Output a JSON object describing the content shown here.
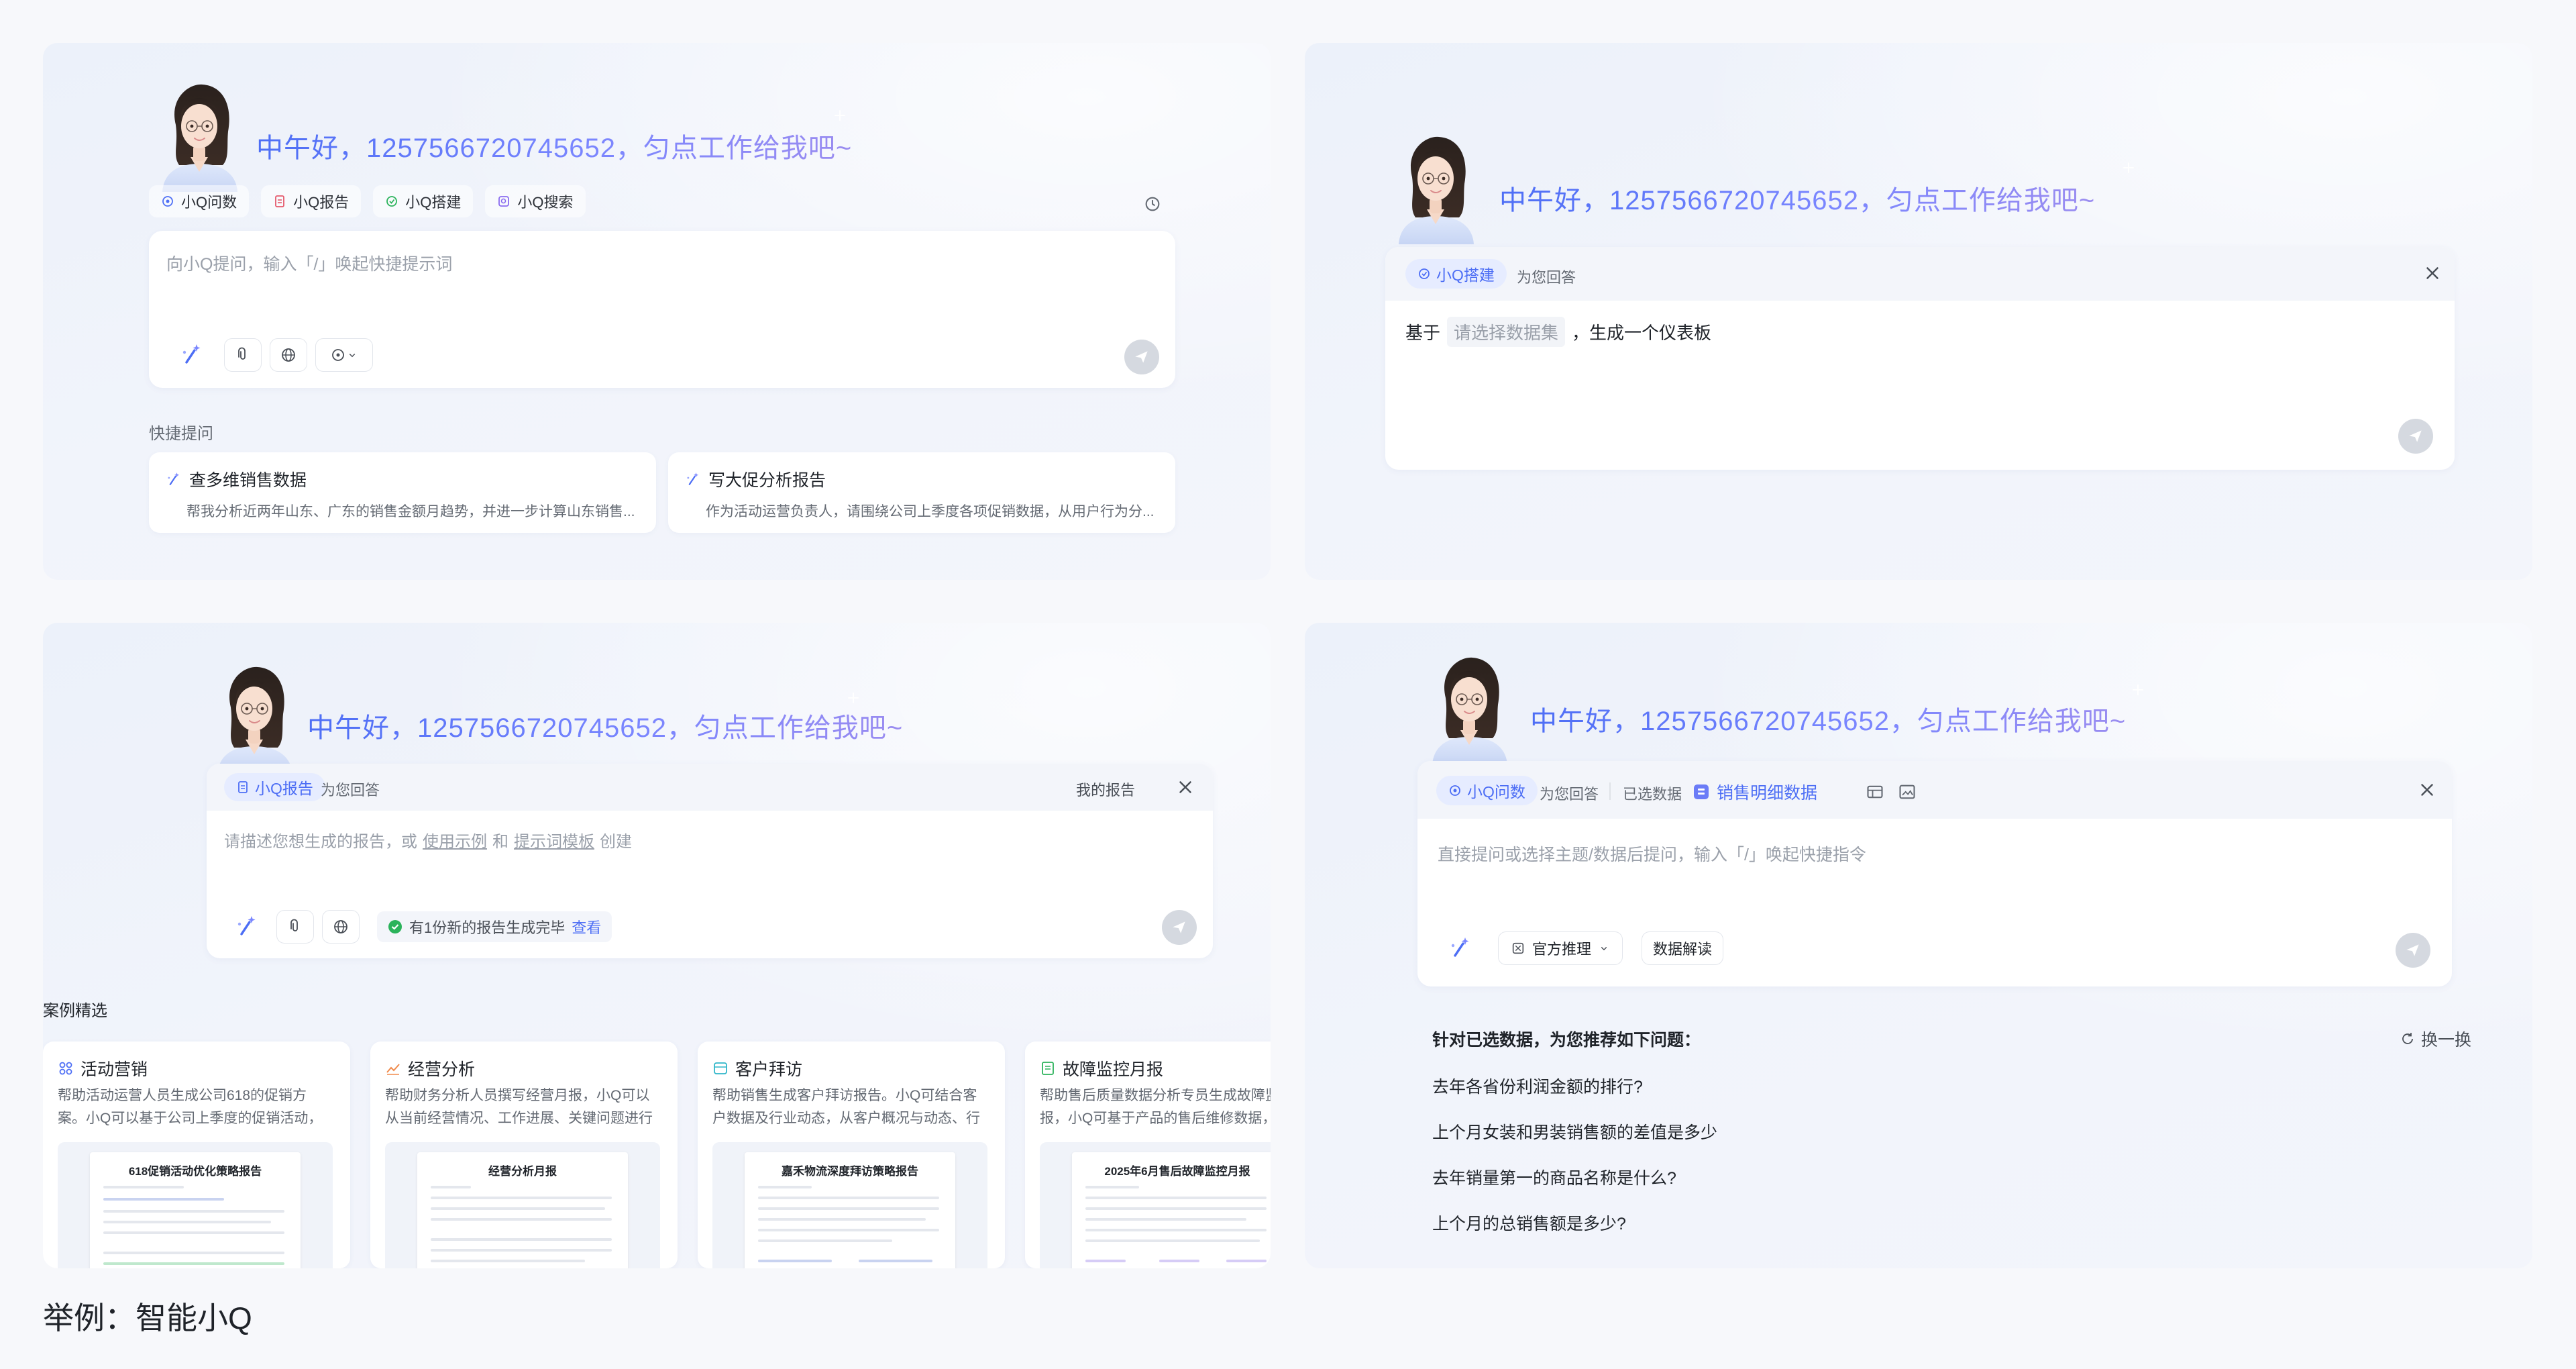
{
  "greeting": "中午好，1257566720745652，匀点工作给我吧~",
  "colors": {
    "accent": "#4d6ef5",
    "accent_soft": "#e6ecff",
    "success": "#2bb35b",
    "send_disabled": "#d5d9e0"
  },
  "panel1": {
    "chips": [
      {
        "icon": "qa-icon",
        "label": "小Q问数"
      },
      {
        "icon": "report-icon",
        "label": "小Q报告"
      },
      {
        "icon": "build-icon",
        "label": "小Q搭建"
      },
      {
        "icon": "search-icon",
        "label": "小Q搜索"
      }
    ],
    "input_placeholder": "向小Q提问，输入「/」唤起快捷提示词",
    "quick_label": "快捷提问",
    "quick": [
      {
        "title": "查多维销售数据",
        "desc": "帮我分析近两年山东、广东的销售金额月趋势，并进一步计算山东销售..."
      },
      {
        "title": "写大促分析报告",
        "desc": "作为活动运营负责人，请围绕公司上季度各项促销数据，从用户行为分..."
      }
    ]
  },
  "panel2": {
    "tag": "小Q搭建",
    "tag_suffix": "为您回答",
    "prompt_prefix": "基于",
    "prompt_slot": "请选择数据集",
    "prompt_suffix": "，生成一个仪表板"
  },
  "panel3": {
    "tag": "小Q报告",
    "tag_suffix": "为您回答",
    "my_reports": "我的报告",
    "placeholder_a": "请描述您想生成的报告，或",
    "placeholder_link1": "使用示例",
    "placeholder_and": "和",
    "placeholder_link2": "提示词模板",
    "placeholder_b": "创建",
    "notice": "有1份新的报告生成完毕",
    "notice_link": "查看",
    "cases_label": "案例精选",
    "cases": [
      {
        "icon": "campaign-icon",
        "icon_color": "#4d6ef5",
        "title": "活动营销",
        "desc": "帮助活动运营人员生成公司618的促销方案。小Q可以基于公司上季度的促销活动，从用户行...",
        "doc_title": "618促销活动优化策略报告"
      },
      {
        "icon": "chart-icon",
        "icon_color": "#f08a4b",
        "title": "经营分析",
        "desc": "帮助财务分析人员撰写经营月报，小Q可以从当前经营情况、工作进展、关键问题进行归因总...",
        "doc_title": "经营分析月报"
      },
      {
        "icon": "visit-icon",
        "icon_color": "#2fb6c9",
        "title": "客户拜访",
        "desc": "帮助销售生成客户拜访报告。小Q可结合客户数据及行业动态，从客户概况与动态、行业洞...",
        "doc_title": "嘉禾物流深度拜访策略报告"
      },
      {
        "icon": "monitor-icon",
        "icon_color": "#2bb35b",
        "title": "故障监控月报",
        "desc": "帮助售后质量数据分析专员生成故障监控月报，小Q可基于产品的售后维修数据，从...",
        "doc_title": "2025年6月售后故障监控月报"
      }
    ]
  },
  "panel4": {
    "tag": "小Q问数",
    "tag_suffix": "为您回答",
    "selected_label": "已选数据",
    "dataset": "销售明细数据",
    "placeholder": "直接提问或选择主题/数据后提问，输入「/」唤起快捷指令",
    "official_btn": "官方推理",
    "interpret_btn": "数据解读",
    "rec_title": "针对已选数据，为您推荐如下问题：",
    "refresh": "换一换",
    "questions": [
      "去年各省份利润金额的排行?",
      "上个月女装和男装销售额的差值是多少",
      "去年销量第一的商品名称是什么?",
      "上个月的总销售额是多少?"
    ]
  },
  "caption": "举例：智能小Q"
}
